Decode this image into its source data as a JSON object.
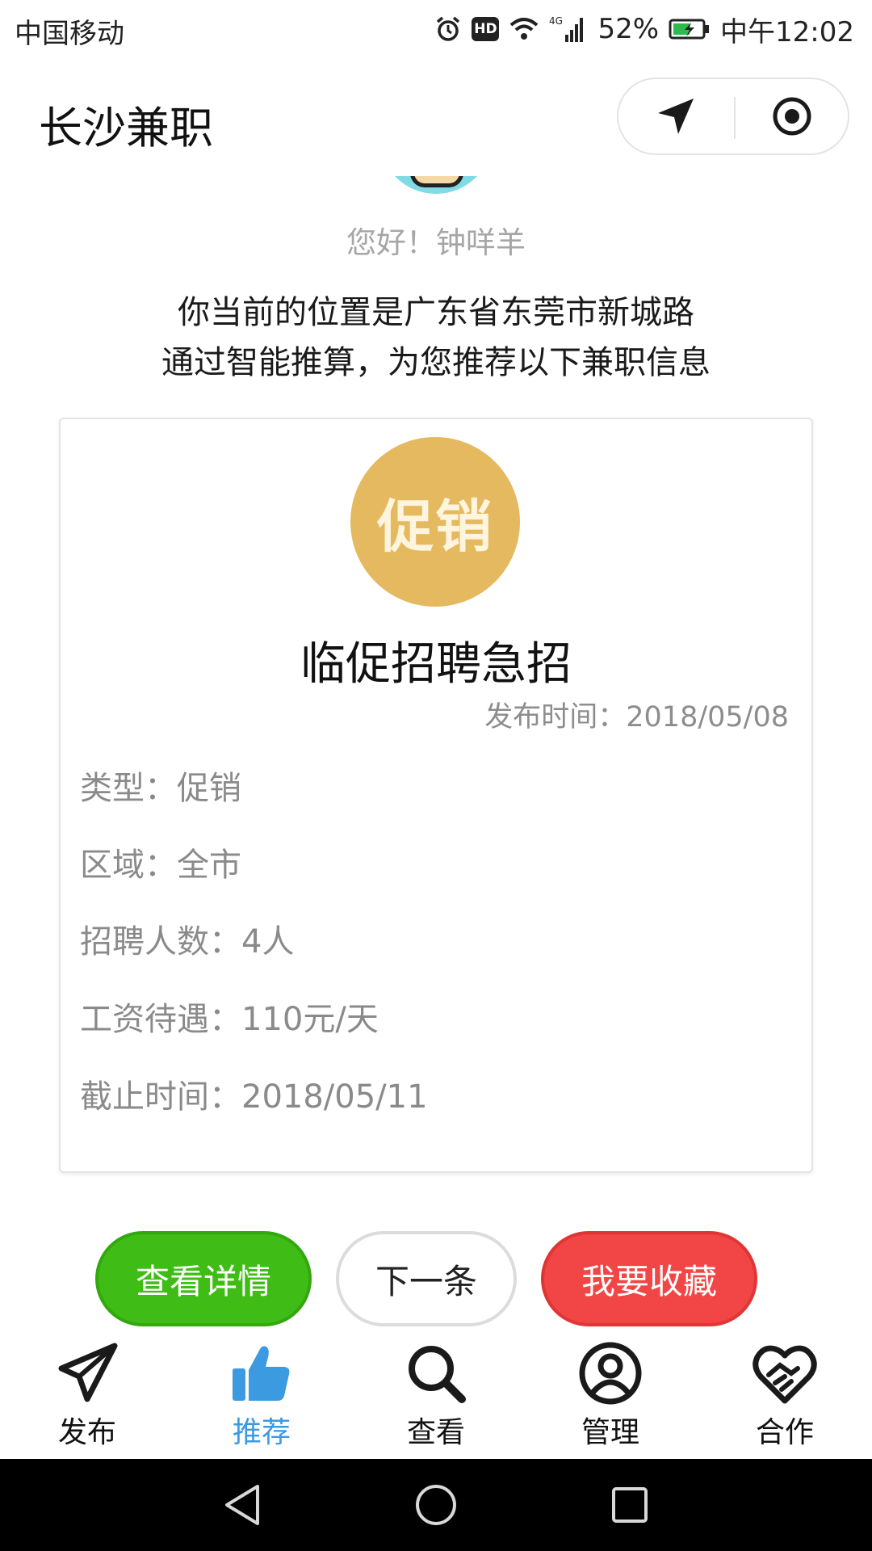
{
  "status_bar": {
    "carrier": "中国移动",
    "network": "4G",
    "battery": "52%",
    "time": "中午12:02"
  },
  "header": {
    "title": "长沙兼职"
  },
  "greeting": "您好！钟咩羊",
  "location_lines": [
    "你当前的位置是广东省东莞市新城路",
    "通过智能推算，为您推荐以下兼职信息"
  ],
  "job_card": {
    "badge_text": "促销",
    "title": "临促招聘急招",
    "publish_time": "发布时间：2018/05/08",
    "details": [
      "类型：促销",
      "区域：全市",
      "招聘人数：4人",
      "工资待遇：110元/天",
      "截止时间：2018/05/11"
    ]
  },
  "actions": {
    "detail": "查看详情",
    "next": "下一条",
    "favorite": "我要收藏"
  },
  "tabs": [
    {
      "label": "发布",
      "icon": "send-icon"
    },
    {
      "label": "推荐",
      "icon": "thumbs-up-icon"
    },
    {
      "label": "查看",
      "icon": "search-icon"
    },
    {
      "label": "管理",
      "icon": "user-circle-icon"
    },
    {
      "label": "合作",
      "icon": "handshake-icon"
    }
  ],
  "active_tab_index": 1,
  "colors": {
    "active_tab": "#3b9ae0",
    "detail_button": "#3fbd16",
    "favorite_button": "#f24545",
    "badge": "#e5b95f"
  }
}
